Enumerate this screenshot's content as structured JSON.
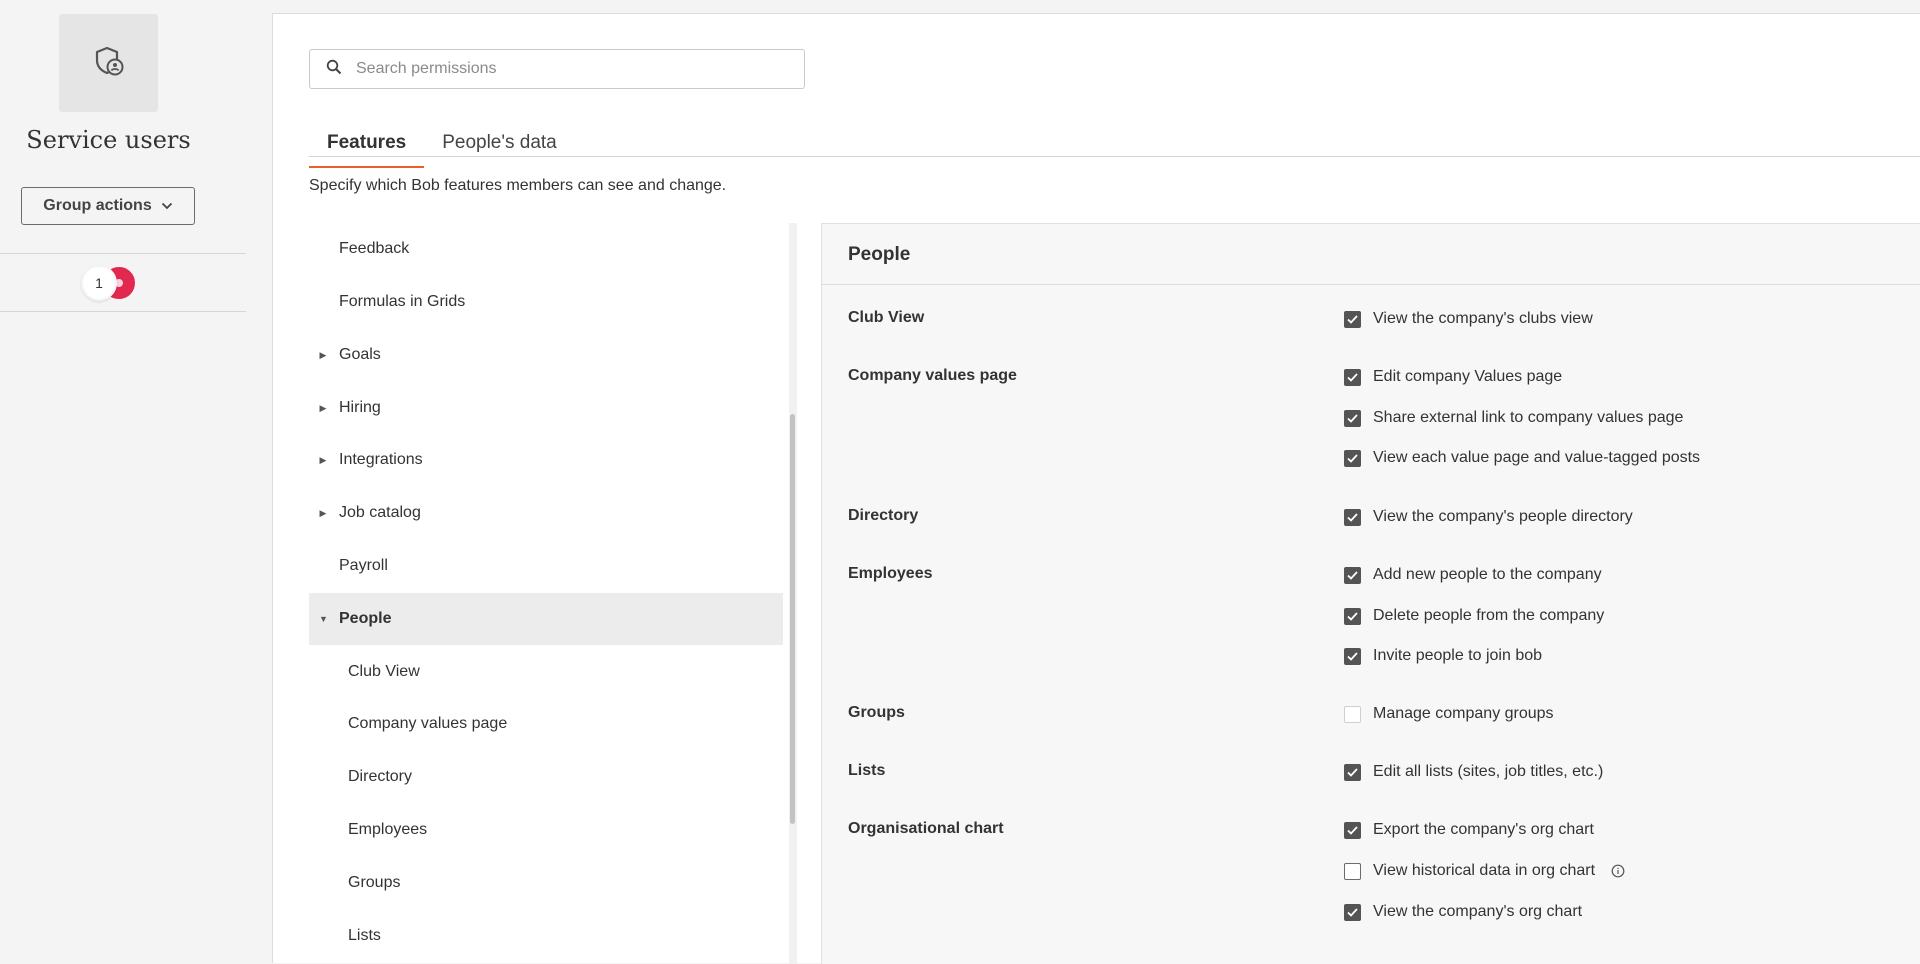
{
  "sidebar": {
    "group_icon": "shield-user-icon",
    "title": "Service users",
    "group_actions_label": "Group actions",
    "member_count": "1"
  },
  "search": {
    "placeholder": "Search permissions",
    "value": ""
  },
  "tabs": [
    {
      "label": "Features",
      "active": true
    },
    {
      "label": "People's data",
      "active": false
    }
  ],
  "description": "Specify which Bob features members can see and change.",
  "tree": [
    {
      "label": "Feedback",
      "caret": "",
      "selected": false
    },
    {
      "label": "Formulas in Grids",
      "caret": "",
      "selected": false
    },
    {
      "label": "Goals",
      "caret": "collapsed",
      "selected": false
    },
    {
      "label": "Hiring",
      "caret": "collapsed",
      "selected": false
    },
    {
      "label": "Integrations",
      "caret": "collapsed",
      "selected": false
    },
    {
      "label": "Job catalog",
      "caret": "collapsed",
      "selected": false
    },
    {
      "label": "Payroll",
      "caret": "",
      "selected": false
    },
    {
      "label": "People",
      "caret": "expanded",
      "selected": true
    },
    {
      "label": "Club View",
      "caret": "",
      "selected": false,
      "child": true
    },
    {
      "label": "Company values page",
      "caret": "",
      "selected": false,
      "child": true
    },
    {
      "label": "Directory",
      "caret": "",
      "selected": false,
      "child": true
    },
    {
      "label": "Employees",
      "caret": "",
      "selected": false,
      "child": true
    },
    {
      "label": "Groups",
      "caret": "",
      "selected": false,
      "child": true
    },
    {
      "label": "Lists",
      "caret": "",
      "selected": false,
      "child": true
    }
  ],
  "panel": {
    "title": "People",
    "sections": [
      {
        "label": "Club View",
        "permissions": [
          {
            "label": "View the company's clubs view",
            "checked": true
          }
        ]
      },
      {
        "label": "Company values page",
        "permissions": [
          {
            "label": "Edit company Values page",
            "checked": true
          },
          {
            "label": "Share external link to company values page",
            "checked": true
          },
          {
            "label": "View each value page and value-tagged posts",
            "checked": true
          }
        ]
      },
      {
        "label": "Directory",
        "permissions": [
          {
            "label": "View the company's people directory",
            "checked": true
          }
        ]
      },
      {
        "label": "Employees",
        "permissions": [
          {
            "label": "Add new people to the company",
            "checked": true
          },
          {
            "label": "Delete people from the company",
            "checked": true
          },
          {
            "label": "Invite people to join bob",
            "checked": true
          }
        ]
      },
      {
        "label": "Groups",
        "permissions": [
          {
            "label": "Manage company groups",
            "checked": false,
            "disabled": true
          }
        ]
      },
      {
        "label": "Lists",
        "permissions": [
          {
            "label": "Edit all lists (sites, job titles, etc.)",
            "checked": true
          }
        ]
      },
      {
        "label": "Organisational chart",
        "permissions": [
          {
            "label": "Export the company's org chart",
            "checked": true
          },
          {
            "label": "View historical data in org chart",
            "checked": false,
            "info": true
          },
          {
            "label": "View the company's org chart",
            "checked": true
          }
        ]
      }
    ]
  },
  "colors": {
    "accent": "#e8602d",
    "avatar": "#e2284f",
    "checkbox_on": "#545454"
  }
}
